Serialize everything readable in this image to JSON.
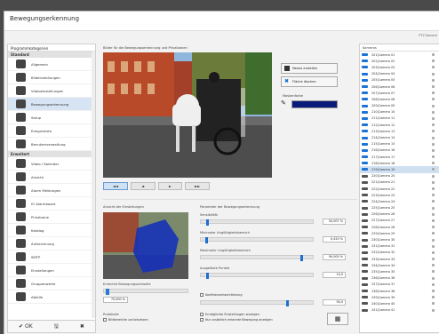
{
  "window": {
    "title": "Bewegungserkennung",
    "badge": "PTZ Kamera"
  },
  "left": {
    "header": "Programmkategorien",
    "sections": {
      "standard": "Standard",
      "erweitert": "Erweitert"
    },
    "items_standard": [
      {
        "label": "Allgemein",
        "icon": "camera-icon"
      },
      {
        "label": "Bildeinstellungen",
        "icon": "image-settings-icon"
      },
      {
        "label": "Videoeinstellungen",
        "icon": "video-settings-icon"
      },
      {
        "label": "Bewegungserkennung",
        "icon": "motion-icon",
        "selected": true
      },
      {
        "label": "Setup",
        "icon": "clock-icon"
      },
      {
        "label": "Ereignisliste",
        "icon": "list-icon"
      },
      {
        "label": "Benutzerverwaltung",
        "icon": "users-icon"
      }
    ],
    "items_erweitert": [
      {
        "label": "Video / Kalender",
        "icon": "calendar-icon"
      },
      {
        "label": "Ansicht",
        "icon": "view-icon"
      },
      {
        "label": "Alarm Meldungen",
        "icon": "alarm-icon"
      },
      {
        "label": "IO Alarmboard",
        "icon": "io-icon"
      },
      {
        "label": "Privatzone",
        "icon": "shield-icon"
      },
      {
        "label": "Katalog",
        "icon": "catalog-icon"
      },
      {
        "label": "Aufzeichnung",
        "icon": "record-icon"
      },
      {
        "label": "SMTP",
        "icon": "mail-icon"
      },
      {
        "label": "Einstellungen",
        "icon": "settings-icon"
      },
      {
        "label": "Gruppenwerte",
        "icon": "group-icon"
      },
      {
        "label": "Abhilfe",
        "icon": "help-icon"
      }
    ],
    "footer": [
      "✔ OK",
      "🖫",
      "✖"
    ]
  },
  "center": {
    "video_label": "Bilder für die Bewegungserkennung und Privatzonen",
    "btn_add": "Neues erstellen",
    "btn_del": "Fläche löschen",
    "color_label": "Maskenfarbe",
    "tabs": [
      "◄◄",
      "◄",
      "►",
      "►►"
    ],
    "thumb_label": "Ansicht der Einstellungen",
    "threshold_label": "Erreichte Bewegungsschwelle",
    "threshold_value": "70,000 %",
    "params_title": "Parameter der Bewegungserkennung",
    "params": [
      {
        "label": "Sensibilität",
        "value": "50,007 %",
        "level": 0.05
      },
      {
        "label": "Minimaler Ungültigkeitsbereich",
        "value": "0,420 %",
        "level": 0.04
      },
      {
        "label": "Maximaler Ungültigkeitsbereich",
        "value": "90,000 %",
        "level": 0.9
      },
      {
        "label": "Ausgelöste Punkte",
        "value": "10,0",
        "level": 0.05
      }
    ],
    "chk_conf": "Konfidenzeinschränkung",
    "conf_value": "90,0",
    "prot_label": "Protokolle",
    "chk_prot": "Bildbereiche zurücksetzen",
    "chk_a": "Ermöglichte Einstellungen anzeigen",
    "chk_b": "Nur zusätzlich erkannte Bewegung anzeigen"
  },
  "cameras": {
    "header": "Kameras",
    "items": [
      "201|Camera 01",
      "202|Camera 02",
      "203|Camera 03",
      "204|Camera 04",
      "205|Camera 05",
      "206|Camera 06",
      "207|Camera 07",
      "208|Camera 08",
      "209|Camera 09",
      "210|Camera 10",
      "211|Camera 11",
      "212|Camera 12",
      "213|Camera 13",
      "214|Camera 14",
      "215|Camera 15",
      "216|Camera 16",
      "217|Camera 17",
      "218|Camera 18",
      "219|Camera 19",
      "220|Camera 20",
      "221|Camera 21",
      "222|Camera 22",
      "223|Camera 23",
      "224|Camera 24",
      "225|Camera 25",
      "226|Camera 26",
      "227|Camera 27",
      "228|Camera 28",
      "229|Camera 29",
      "230|Camera 30",
      "231|Camera 31",
      "232|Camera 32",
      "233|Camera 33",
      "234|Camera 34",
      "235|Camera 35",
      "236|Camera 36",
      "237|Camera 37",
      "238|Camera 38",
      "239|Camera 39",
      "240|Camera 40",
      "241|Camera 41"
    ]
  }
}
